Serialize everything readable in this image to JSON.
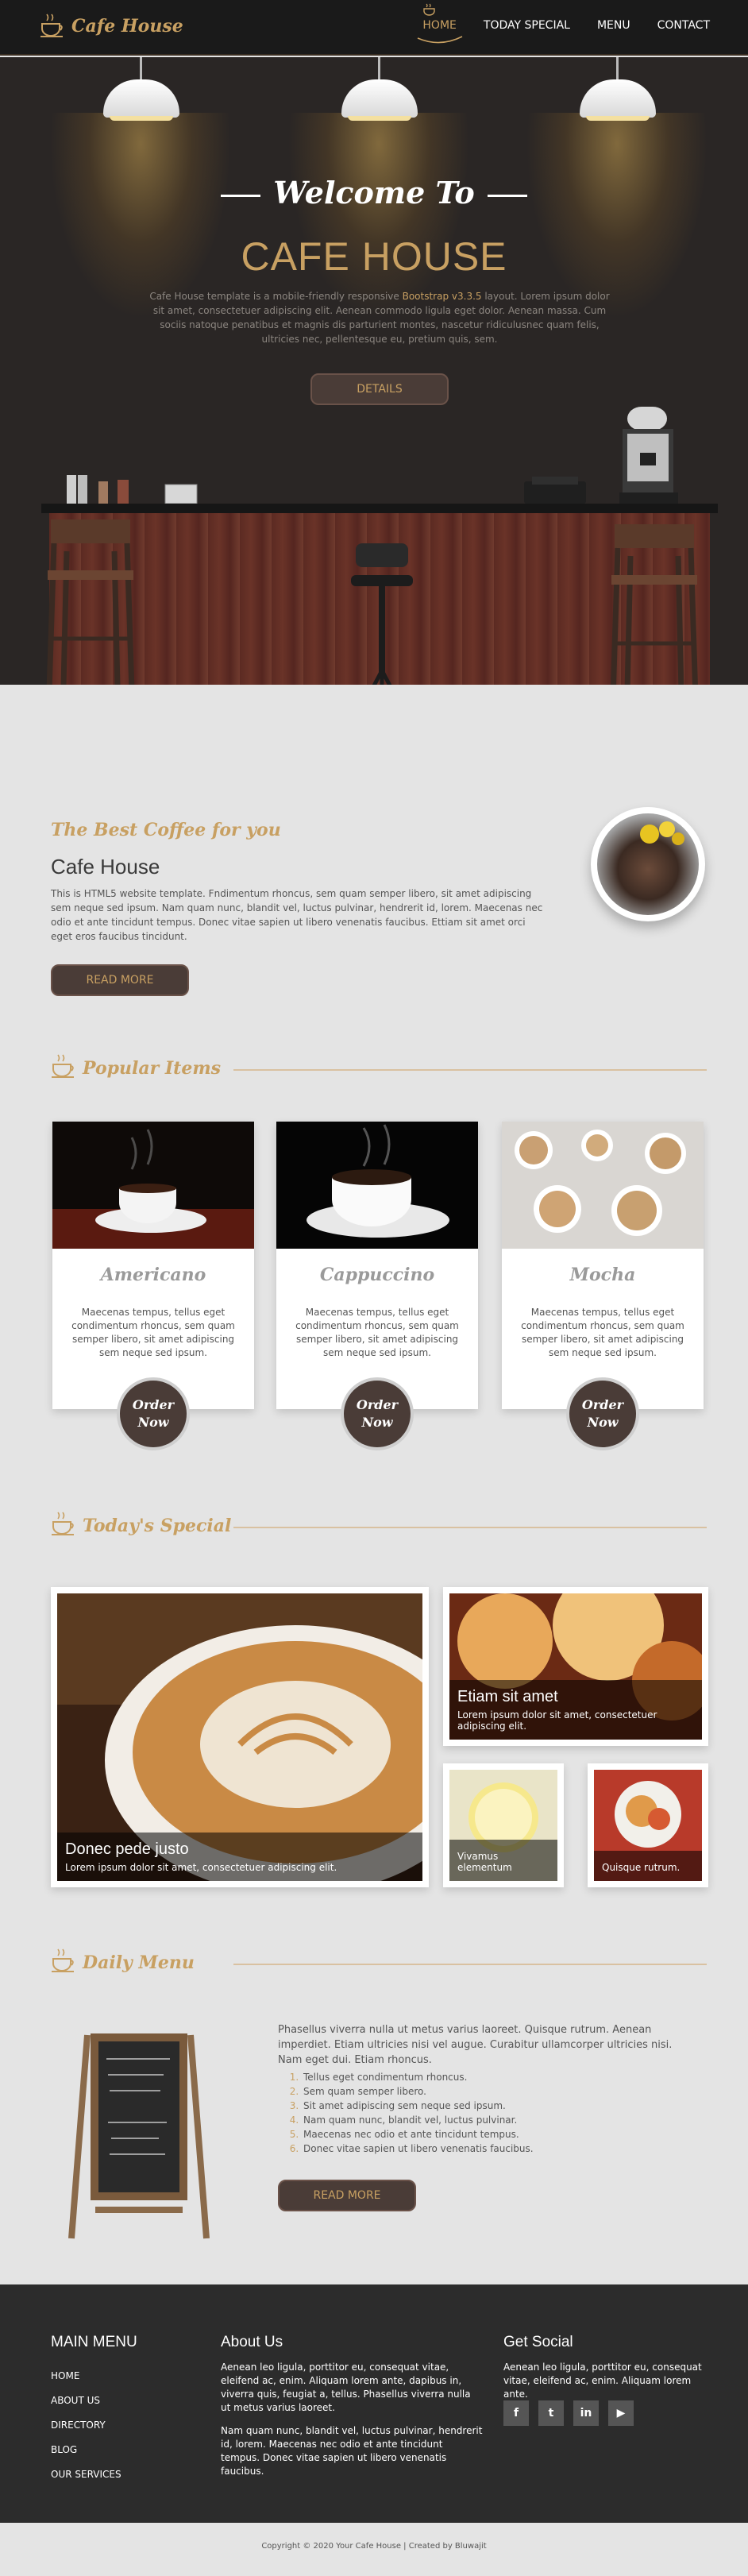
{
  "brand": {
    "name": "Cafe House"
  },
  "nav": {
    "items": [
      {
        "label": "HOME",
        "active": true
      },
      {
        "label": "TODAY SPECIAL",
        "active": false
      },
      {
        "label": "MENU",
        "active": false
      },
      {
        "label": "CONTACT",
        "active": false
      }
    ]
  },
  "hero": {
    "welcome": "Welcome To",
    "title": "CAFE HOUSE",
    "desc_before": "Cafe House template is a mobile-friendly responsive ",
    "desc_link": "Bootstrap v3.3.5",
    "desc_after": " layout. Lorem ipsum dolor sit amet, consectetuer adipiscing elit. Aenean commodo ligula eget dolor. Aenean massa. Cum sociis natoque penatibus et magnis dis parturient montes, nascetur ridiculusnec quam felis, ultricies nec, pellentesque eu, pretium quis, sem.",
    "button": "DETAILS"
  },
  "about": {
    "subtitle": "The Best Coffee for you",
    "title": "Cafe House",
    "text": "This is HTML5 website template. Fndimentum rhoncus, sem quam semper libero, sit amet adipiscing sem neque sed ipsum. Nam quam nunc, blandit vel, luctus pulvinar, hendrerit id, lorem. Maecenas nec odio et ante tincidunt tempus. Donec vitae sapien ut libero venenatis faucibus. Ettiam sit amet orci eget eros faucibus tincidunt.",
    "button": "READ MORE"
  },
  "popular": {
    "title": "Popular Items",
    "items": [
      {
        "name": "Americano",
        "desc": "Maecenas tempus, tellus eget condimentum rhoncus, sem quam semper libero, sit amet adipiscing sem neque sed ipsum.",
        "order": "Order Now"
      },
      {
        "name": "Cappuccino",
        "desc": "Maecenas tempus, tellus eget condimentum rhoncus, sem quam semper libero, sit amet adipiscing sem neque sed ipsum.",
        "order": "Order Now"
      },
      {
        "name": "Mocha",
        "desc": "Maecenas tempus, tellus eget condimentum rhoncus, sem quam semper libero, sit amet adipiscing sem neque sed ipsum.",
        "order": "Order Now"
      }
    ]
  },
  "special": {
    "title": "Today's Special",
    "items": [
      {
        "title": "Donec pede justo",
        "desc": "Lorem ipsum dolor sit amet, consectetuer adipiscing elit."
      },
      {
        "title": "Etiam sit amet",
        "desc": "Lorem ipsum dolor sit amet, consectetuer adipiscing elit."
      },
      {
        "title": "",
        "desc": "Vivamus elementum"
      },
      {
        "title": "",
        "desc": "Quisque rutrum."
      }
    ]
  },
  "daily": {
    "title": "Daily Menu",
    "text": "Phasellus viverra nulla ut metus varius laoreet. Quisque rutrum. Aenean imperdiet. Etiam ultricies nisi vel augue. Curabitur ullamcorper ultricies nisi. Nam eget dui. Etiam rhoncus.",
    "items": [
      "Tellus eget condimentum rhoncus.",
      "Sem quam semper libero.",
      "Sit amet adipiscing sem neque sed ipsum.",
      "Nam quam nunc, blandit vel, luctus pulvinar.",
      "Maecenas nec odio et ante tincidunt tempus.",
      "Donec vitae sapien ut libero venenatis faucibus."
    ],
    "button": "READ MORE"
  },
  "footer": {
    "menu_title": "MAIN MENU",
    "menu": [
      "HOME",
      "ABOUT US",
      "DIRECTORY",
      "BLOG",
      "OUR SERVICES"
    ],
    "about_title": "About Us",
    "about_p1": "Aenean leo ligula, porttitor eu, consequat vitae, eleifend ac, enim. Aliquam lorem ante, dapibus in, viverra quis, feugiat a, tellus. Phasellus viverra nulla ut metus varius laoreet.",
    "about_p2": "Nam quam nunc, blandit vel, luctus pulvinar, hendrerit id, lorem. Maecenas nec odio et ante tincidunt tempus. Donec vitae sapien ut libero venenatis faucibus.",
    "social_title": "Get Social",
    "social_text": "Aenean leo ligula, porttitor eu, consequat vitae, eleifend ac, enim. Aliquam lorem ante.",
    "social_icons": [
      "facebook-icon",
      "twitter-icon",
      "linkedin-icon",
      "youtube-icon"
    ],
    "social_glyphs": [
      "f",
      "t",
      "in",
      "▶"
    ],
    "copyright": "Copyright © 2020 Your Cafe House | Created by Bluwajit"
  },
  "colors": {
    "accent": "#c8a062",
    "dark": "#2a2625",
    "button": "#4a3c37",
    "footer": "#2c2c2c"
  }
}
